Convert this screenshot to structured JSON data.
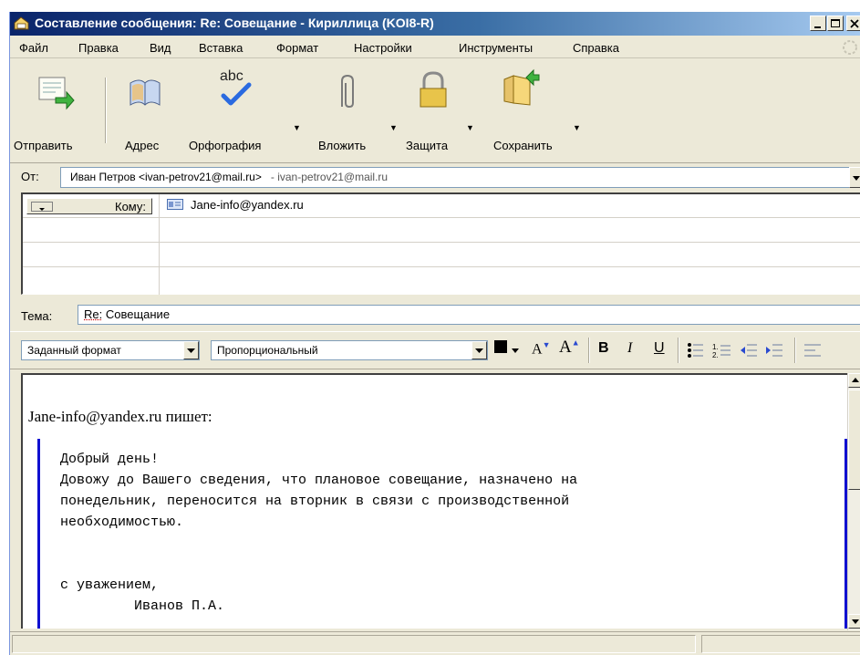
{
  "window": {
    "title": "Составление сообщения: Re: Совещание - Кириллица (KOI8-R)",
    "title_color": "#0a246a"
  },
  "menu": [
    {
      "label": "Файл"
    },
    {
      "label": "Правка"
    },
    {
      "label": "Вид"
    },
    {
      "label": "Вставка"
    },
    {
      "label": "Формат"
    },
    {
      "label": "Настройки"
    },
    {
      "label": "Инструменты"
    },
    {
      "label": "Справка"
    }
  ],
  "toolbar": {
    "send": "Отправить",
    "address": "Адрес",
    "spelling": "Орфография",
    "attach": "Вложить",
    "security": "Защита",
    "save": "Сохранить",
    "spelling_icon_text": "abc"
  },
  "from": {
    "label": "От:",
    "value": "Иван Петров <ivan-petrov21@mail.ru>",
    "account": "- ivan-petrov21@mail.ru"
  },
  "recipients": {
    "type_label": "Кому:",
    "to": "Jane-info@yandex.ru"
  },
  "subject": {
    "label": "Тема:",
    "prefix": "Re:",
    "value": " Совещание"
  },
  "format": {
    "paragraph_style": "Заданный формат",
    "font": "Пропорциональный",
    "bold": "B",
    "italic": "I",
    "underline": "U",
    "text_color": "#000000",
    "quote_bar_color": "#1010d0"
  },
  "body": {
    "wrote_line": "Jane-info@yandex.ru пишет:",
    "quote_lines": [
      "Добрый день!",
      "Довожу до Вашего сведения, что плановое совещание, назначено на",
      "понедельник, переносится на вторник в связи с производственной",
      "необходимостью.",
      "",
      "",
      "с уважением,",
      "         Иванов П.А."
    ]
  }
}
